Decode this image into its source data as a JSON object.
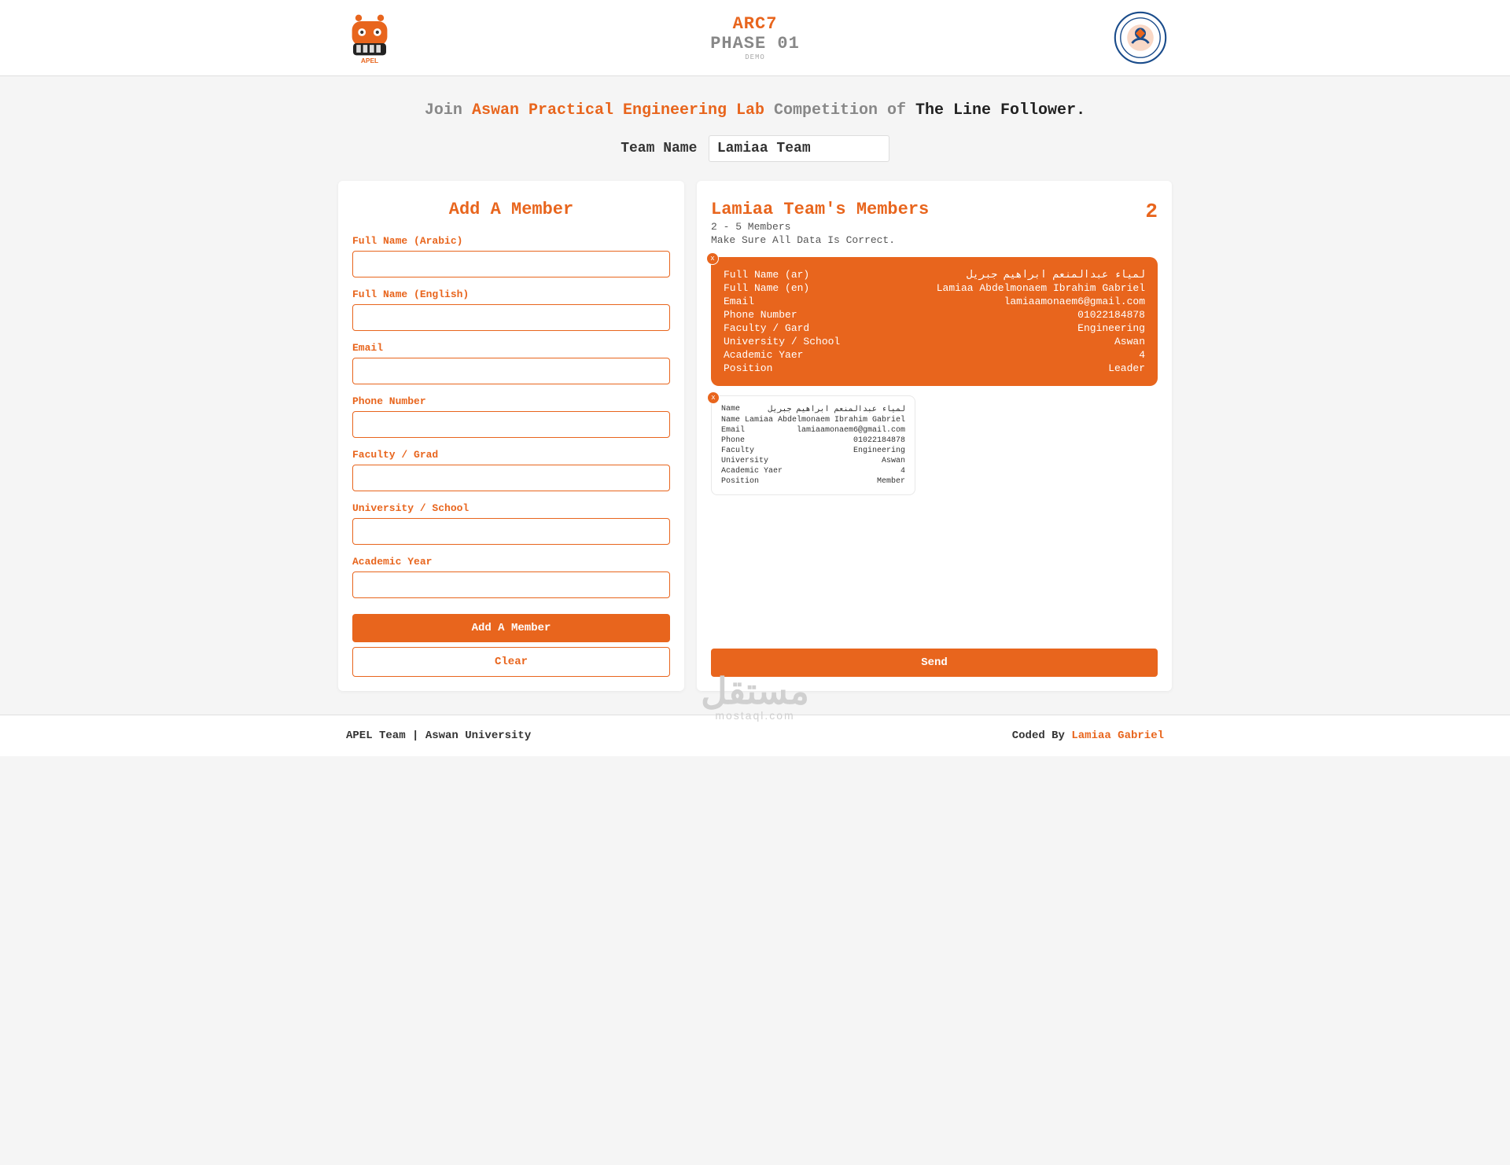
{
  "header": {
    "arc": "ARC7",
    "phase": "PHASE 01",
    "demo": "DEMO",
    "logo_left_alt": "APEL robot logo",
    "logo_right_alt": "Aswan University logo"
  },
  "tagline": {
    "join": "Join ",
    "lab": "Aswan Practical Engineering Lab",
    "competition_of": " Competition of ",
    "track": "The Line Follower."
  },
  "team": {
    "label": "Team Name",
    "value": "Lamiaa Team"
  },
  "form": {
    "title": "Add A Member",
    "fields": {
      "name_ar": "Full Name (Arabic)",
      "name_en": "Full Name (English)",
      "email": "Email",
      "phone": "Phone Number",
      "faculty": "Faculty / Grad",
      "university": "University / School",
      "year": "Academic Year"
    },
    "add_btn": "Add A Member",
    "clear_btn": "Clear"
  },
  "members_panel": {
    "title": "Lamiaa Team's Members",
    "count": "2",
    "range": "2 - 5 Members",
    "note": "Make Sure All Data Is Correct.",
    "send_btn": "Send"
  },
  "leader_labels": {
    "name_ar": "Full Name (ar)",
    "name_en": "Full Name (en)",
    "email": "Email",
    "phone": "Phone Number",
    "faculty": "Faculty / Gard",
    "university": "University / School",
    "year": "Academic Yaer",
    "position": "Position"
  },
  "member_labels": {
    "name_ar": "Name",
    "name_en": "Name",
    "email": "Email",
    "phone": "Phone",
    "faculty": "Faculty",
    "university": "University",
    "year": "Academic Yaer",
    "position": "Position"
  },
  "members": [
    {
      "name_ar": "لمياء عبدالمنعم ابراهيم جبريل",
      "name_en": "Lamiaa Abdelmonaem Ibrahim Gabriel",
      "email": "lamiaamonaem6@gmail.com",
      "phone": "01022184878",
      "faculty": "Engineering",
      "university": "Aswan",
      "year": "4",
      "position": "Leader"
    },
    {
      "name_ar": "لمياء عبدالمنعم ابراهيم جبريل",
      "name_en": "Lamiaa Abdelmonaem Ibrahim Gabriel",
      "email": "lamiaamonaem6@gmail.com",
      "phone": "01022184878",
      "faculty": "Engineering",
      "university": "Aswan",
      "year": "4",
      "position": "Member"
    }
  ],
  "footer": {
    "left": "APEL Team | Aswan University",
    "right_prefix": "Coded By ",
    "right_name": "Lamiaa Gabriel"
  },
  "watermark": {
    "ar": "مستقل",
    "en": "mostaql.com"
  }
}
